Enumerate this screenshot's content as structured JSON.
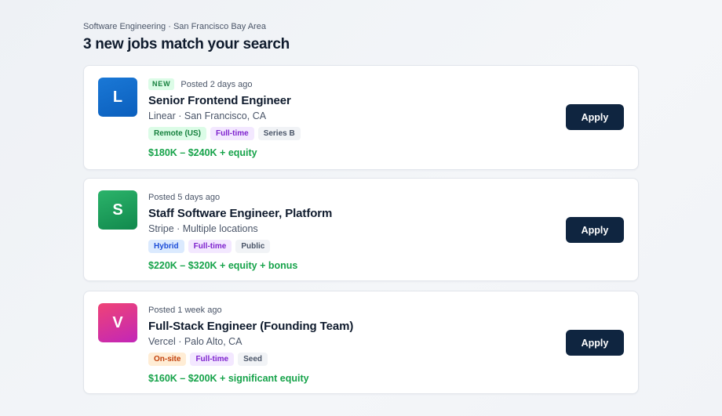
{
  "header": {
    "subtitle": "Software Engineering · San Francisco Bay Area",
    "title": "3 new jobs match your search"
  },
  "jobs": [
    {
      "logo_letter": "L",
      "new_badge": "NEW",
      "posted": "Posted 2 days ago",
      "title": "Senior Frontend Engineer",
      "company_location": "Linear · San Francisco, CA",
      "tags": [
        "Remote (US)",
        "Full-time",
        "Series B"
      ],
      "salary": "$180K – $240K + equity",
      "apply_label": "Apply",
      "logo_color": "#0b5fbd"
    },
    {
      "logo_letter": "S",
      "posted": "Posted 5 days ago",
      "title": "Staff Software Engineer, Platform",
      "company_location": "Stripe · Multiple locations",
      "tags": [
        "Hybrid",
        "Full-time",
        "Public"
      ],
      "salary": "$220K – $320K + equity + bonus",
      "apply_label": "Apply",
      "logo_color": "#11894d"
    },
    {
      "logo_letter": "V",
      "posted": "Posted 1 week ago",
      "title": "Full-Stack Engineer (Founding Team)",
      "company_location": "Vercel · Palo Alto, CA",
      "tags": [
        "On-site",
        "Full-time",
        "Seed"
      ],
      "salary": "$160K – $200K + significant equity",
      "apply_label": "Apply",
      "logo_color": "#c226b8"
    }
  ],
  "colors": {
    "accent_button": "#0f2540",
    "salary": "#16a34a",
    "new_badge": "#15803d"
  }
}
